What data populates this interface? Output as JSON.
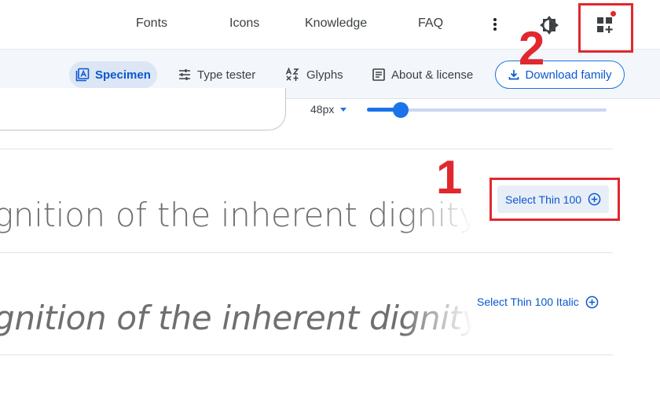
{
  "nav": {
    "links": [
      "Fonts",
      "Icons",
      "Knowledge",
      "FAQ"
    ]
  },
  "tabs": [
    {
      "label": "Specimen",
      "icon": "specimen-icon",
      "active": true
    },
    {
      "label": "Type tester",
      "icon": "tune-icon",
      "active": false
    },
    {
      "label": "Glyphs",
      "icon": "glyphs-icon",
      "active": false
    },
    {
      "label": "About & license",
      "icon": "article-icon",
      "active": false
    }
  ],
  "download_label": "Download family",
  "size": {
    "value_label": "48px",
    "slider_fraction": 0.14
  },
  "styles": [
    {
      "sample": "gnition of the inherent dignity",
      "select_label": "Select Thin 100",
      "italic": false
    },
    {
      "sample": "gnition of the inherent dignity",
      "select_label": "Select Thin 100 Italic",
      "italic": true
    }
  ],
  "annotations": {
    "step1": "1",
    "step2": "2"
  },
  "colors": {
    "accent": "#1a73e8",
    "annotation": "#e0282e",
    "notification_dot": "#e0282e"
  }
}
